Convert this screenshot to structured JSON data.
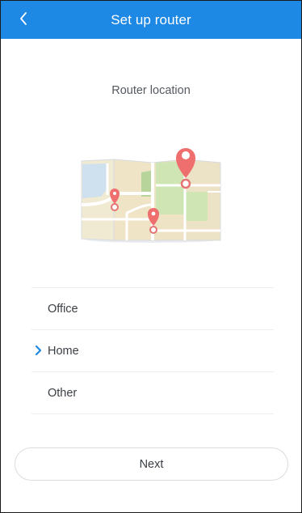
{
  "header": {
    "title": "Set up router",
    "back_icon": "chevron-left-icon",
    "background_color": "#1e88e5"
  },
  "content": {
    "section_title": "Router location",
    "illustration": "map-with-location-pins"
  },
  "locations": {
    "selected_index": 1,
    "items": [
      {
        "label": "Office"
      },
      {
        "label": "Home"
      },
      {
        "label": "Other"
      }
    ],
    "selected_icon": "chevron-right-icon",
    "accent_color": "#1e88e5"
  },
  "footer": {
    "next_label": "Next"
  }
}
